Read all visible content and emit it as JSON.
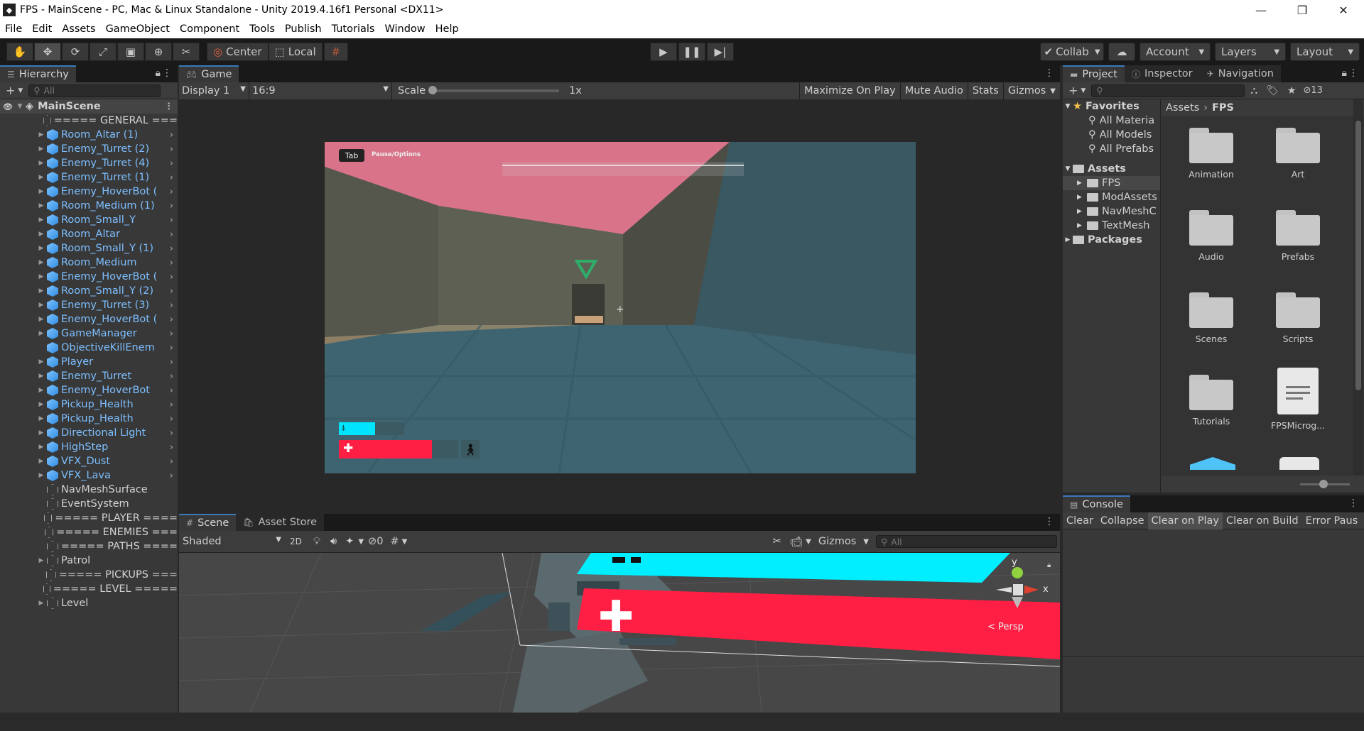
{
  "window": {
    "title": "FPS - MainScene - PC, Mac & Linux Standalone - Unity 2019.4.16f1 Personal <DX11>",
    "minimize": "—",
    "restore": "❐",
    "close": "✕"
  },
  "menu": [
    "File",
    "Edit",
    "Assets",
    "GameObject",
    "Component",
    "Tools",
    "Publish",
    "Tutorials",
    "Window",
    "Help"
  ],
  "toolbar": {
    "tools": [
      "hand-icon",
      "move-icon",
      "rotate-icon",
      "scale-icon",
      "rect-icon",
      "transform-icon",
      "custom-tool-icon"
    ],
    "pivot": "Center",
    "space": "Local",
    "collab": "Collab",
    "account": "Account",
    "layers": "Layers",
    "layout": "Layout"
  },
  "hierarchy": {
    "tab": "Hierarchy",
    "search_placeholder": "All",
    "scene": "MainScene",
    "items": [
      {
        "name": "===== GENERAL ===",
        "blue": false,
        "tri": false,
        "chev": false
      },
      {
        "name": "Room_Altar (1)",
        "blue": true,
        "tri": true,
        "chev": true
      },
      {
        "name": "Enemy_Turret (2)",
        "blue": true,
        "tri": true,
        "chev": true
      },
      {
        "name": "Enemy_Turret (4)",
        "blue": true,
        "tri": true,
        "chev": true
      },
      {
        "name": "Enemy_Turret (1)",
        "blue": true,
        "tri": true,
        "chev": true
      },
      {
        "name": "Enemy_HoverBot (",
        "blue": true,
        "tri": true,
        "chev": true
      },
      {
        "name": "Room_Medium (1)",
        "blue": true,
        "tri": true,
        "chev": true
      },
      {
        "name": "Room_Small_Y",
        "blue": true,
        "tri": true,
        "chev": true
      },
      {
        "name": "Room_Altar",
        "blue": true,
        "tri": true,
        "chev": true
      },
      {
        "name": "Room_Small_Y (1)",
        "blue": true,
        "tri": true,
        "chev": true
      },
      {
        "name": "Room_Medium",
        "blue": true,
        "tri": true,
        "chev": true
      },
      {
        "name": "Enemy_HoverBot (",
        "blue": true,
        "tri": true,
        "chev": true
      },
      {
        "name": "Room_Small_Y (2)",
        "blue": true,
        "tri": true,
        "chev": true
      },
      {
        "name": "Enemy_Turret (3)",
        "blue": true,
        "tri": true,
        "chev": true
      },
      {
        "name": "Enemy_HoverBot (",
        "blue": true,
        "tri": true,
        "chev": true
      },
      {
        "name": "GameManager",
        "blue": true,
        "tri": true,
        "chev": true
      },
      {
        "name": "ObjectiveKillEnem",
        "blue": true,
        "tri": false,
        "chev": true
      },
      {
        "name": "Player",
        "blue": true,
        "tri": true,
        "chev": true
      },
      {
        "name": "Enemy_Turret",
        "blue": true,
        "tri": true,
        "chev": true
      },
      {
        "name": "Enemy_HoverBot",
        "blue": true,
        "tri": true,
        "chev": true
      },
      {
        "name": "Pickup_Health",
        "blue": true,
        "tri": true,
        "chev": true
      },
      {
        "name": "Pickup_Health",
        "blue": true,
        "tri": true,
        "chev": true
      },
      {
        "name": "Directional Light",
        "blue": true,
        "tri": true,
        "chev": true
      },
      {
        "name": "HighStep",
        "blue": true,
        "tri": true,
        "chev": true
      },
      {
        "name": "VFX_Dust",
        "blue": true,
        "tri": true,
        "chev": true
      },
      {
        "name": "VFX_Lava",
        "blue": true,
        "tri": true,
        "chev": true
      },
      {
        "name": "NavMeshSurface",
        "blue": false,
        "tri": false,
        "chev": false
      },
      {
        "name": "EventSystem",
        "blue": false,
        "tri": false,
        "chev": false
      },
      {
        "name": "===== PLAYER ====",
        "blue": false,
        "tri": false,
        "chev": false
      },
      {
        "name": "===== ENEMIES ===",
        "blue": false,
        "tri": false,
        "chev": false
      },
      {
        "name": "===== PATHS ====",
        "blue": false,
        "tri": false,
        "chev": false
      },
      {
        "name": "Patrol",
        "blue": false,
        "tri": true,
        "chev": false
      },
      {
        "name": "===== PICKUPS ===",
        "blue": false,
        "tri": false,
        "chev": false
      },
      {
        "name": "===== LEVEL =====",
        "blue": false,
        "tri": false,
        "chev": false
      },
      {
        "name": "Level",
        "blue": false,
        "tri": true,
        "chev": false
      }
    ]
  },
  "game": {
    "tab": "Game",
    "display": "Display 1",
    "aspect": "16:9",
    "scale_label": "Scale",
    "scale_value": "1x",
    "maximize": "Maximize On Play",
    "mute": "Mute Audio",
    "stats": "Stats",
    "gizmos": "Gizmos",
    "hud_tab": "Tab",
    "hud_options": "Pause/Options",
    "jetpack_fill": 0.55,
    "health_fill": 0.78
  },
  "scene": {
    "tabs": [
      "Scene",
      "Asset Store"
    ],
    "shading": "Shaded",
    "mode2d": "2D",
    "hidden_count": "0",
    "gizmos": "Gizmos",
    "search_placeholder": "All",
    "persp": "Persp",
    "axis_y": "y",
    "axis_x": "x"
  },
  "project": {
    "tabs": [
      "Project",
      "Inspector",
      "Navigation"
    ],
    "hidden_count": "13",
    "favorites": "Favorites",
    "fav_items": [
      "All Materia",
      "All Models",
      "All Prefabs"
    ],
    "assets": "Assets",
    "asset_items": [
      "FPS",
      "ModAssets",
      "NavMeshC",
      "TextMesh"
    ],
    "packages": "Packages",
    "breadcrumb": [
      "Assets",
      "FPS"
    ],
    "grid": [
      "Animation",
      "Art",
      "Audio",
      "Prefabs",
      "Scenes",
      "Scripts",
      "Tutorials",
      "FPSMicrog..."
    ]
  },
  "console": {
    "tab": "Console",
    "buttons": [
      "Clear",
      "Collapse",
      "Clear on Play",
      "Clear on Build",
      "Error Paus"
    ]
  },
  "colors": {
    "accent": "#3a79bb",
    "cyan": "#00e5ff",
    "red": "#ff1f44",
    "sky": "#e07a8e",
    "hier_blue": "#7dbfff"
  }
}
